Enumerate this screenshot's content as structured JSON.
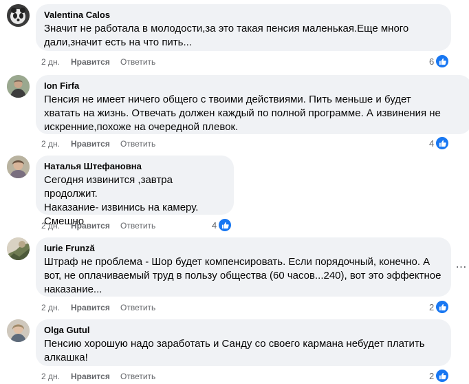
{
  "actions": {
    "time": "2 дн.",
    "like_label": "Нравится",
    "reply_label": "Ответить"
  },
  "comments": [
    {
      "author": "Valentina Calos",
      "text": "Значит не работала в молодости,за это такая пенсия маленькая.Еще много\nдали,значит есть на что пить...",
      "likes": "6"
    },
    {
      "author": "Ion Firfa",
      "text": "Пенсия не имеет ничего общего с твоими действиями. Пить меньше и будет\nхватать на жизнь. Отвечать должен каждый по полной программе. А извинения не\nискренние,похоже на очередной плевок.",
      "likes": "4"
    },
    {
      "author": "Наталья Штефановна",
      "text": "Сегодня извинится ,завтра продолжит.\nНаказание- извинись на камеру.\nСмешно",
      "likes": "4"
    },
    {
      "author": "Iurie Frunză",
      "text": "Штраф не проблема - Шор будет компенсировать. Если порядочный, конечно. А\nвот, не оплачиваемый труд в пользу общества (60 часов...240), вот это эффектное\nнаказание...",
      "likes": "2"
    },
    {
      "author": "Olga Gutul",
      "text": "Пенсию хорошую надо заработать и Санду со своего кармана небудет платить\nалкашка!",
      "likes": "2"
    }
  ],
  "icons": {
    "like": "like-thumb-icon",
    "more": "more-options-icon"
  },
  "colors": {
    "bubble": "#f0f2f5",
    "meta": "#65676b",
    "like_badge": "#1877f2"
  }
}
